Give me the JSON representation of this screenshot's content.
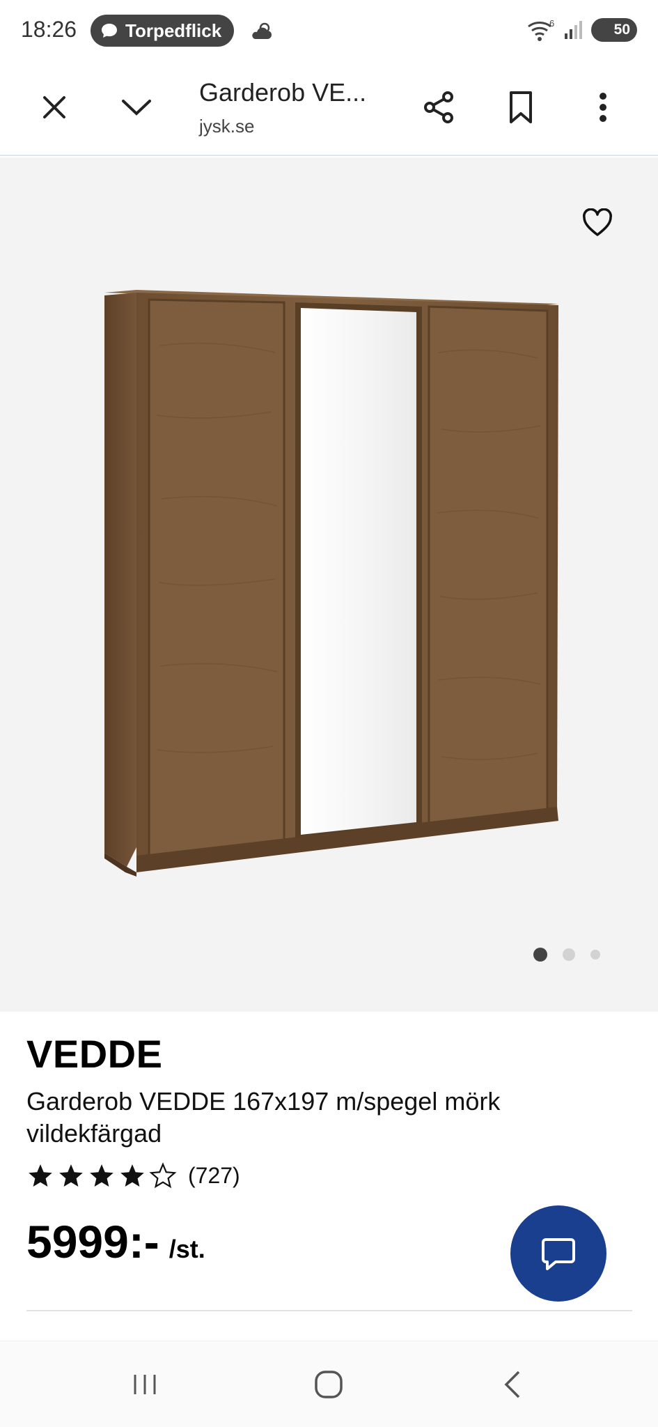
{
  "status_bar": {
    "time": "18:26",
    "notification_app": "Torpedflick",
    "battery": "50",
    "wifi_badge": "6"
  },
  "browser": {
    "page_title": "Garderob VE...",
    "url": "jysk.se",
    "icons": [
      "close-icon",
      "chevron-down-icon",
      "share-icon",
      "bookmark-icon",
      "more-vert-icon"
    ]
  },
  "gallery": {
    "image_count": 3,
    "active_index": 0,
    "favorite_icon": "heart-outline-icon"
  },
  "product": {
    "brand": "VEDDE",
    "name": "Garderob VEDDE 167x197 m/spegel mörk vildekfärgad",
    "rating_value": 4,
    "rating_max": 5,
    "rating_count": "(727)",
    "price": "5999:-",
    "unit": "/st."
  },
  "colors": {
    "chat_button": "#1a3f8f",
    "gallery_bg": "#f3f3f4",
    "wood": "#7a5a3a"
  },
  "nav": {
    "icons": [
      "recents-icon",
      "home-icon",
      "back-icon"
    ]
  }
}
